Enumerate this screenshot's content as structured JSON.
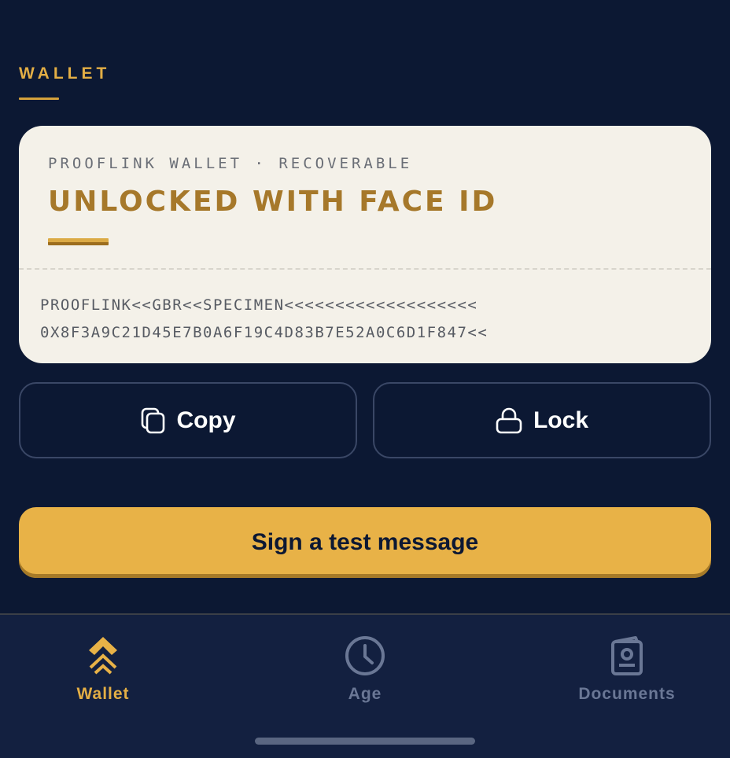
{
  "section": {
    "label": "WALLET"
  },
  "card": {
    "eyebrow": "PROOFLINK WALLET · RECOVERABLE",
    "title": "UNLOCKED WITH FACE ID",
    "code_line1": "PROOFLINK<<GBR<<SPECIMEN<<<<<<<<<<<<<<<<<<<",
    "code_line2": "0X8F3A9C21D45E7B0A6F19C4D83B7E52A0C6D1F847<<"
  },
  "actions": {
    "copy_label": "Copy",
    "lock_label": "Lock",
    "sign_label": "Sign a test message"
  },
  "tabs": [
    {
      "label": "Wallet",
      "icon": "wallet-chevrons-icon",
      "active": true
    },
    {
      "label": "Age",
      "icon": "clock-icon",
      "active": false
    },
    {
      "label": "Documents",
      "icon": "document-id-icon",
      "active": false
    }
  ],
  "colors": {
    "background": "#0c1833",
    "accent": "#e8b247",
    "card": "#f4f1e9",
    "inactive_tab": "#6a7795"
  }
}
